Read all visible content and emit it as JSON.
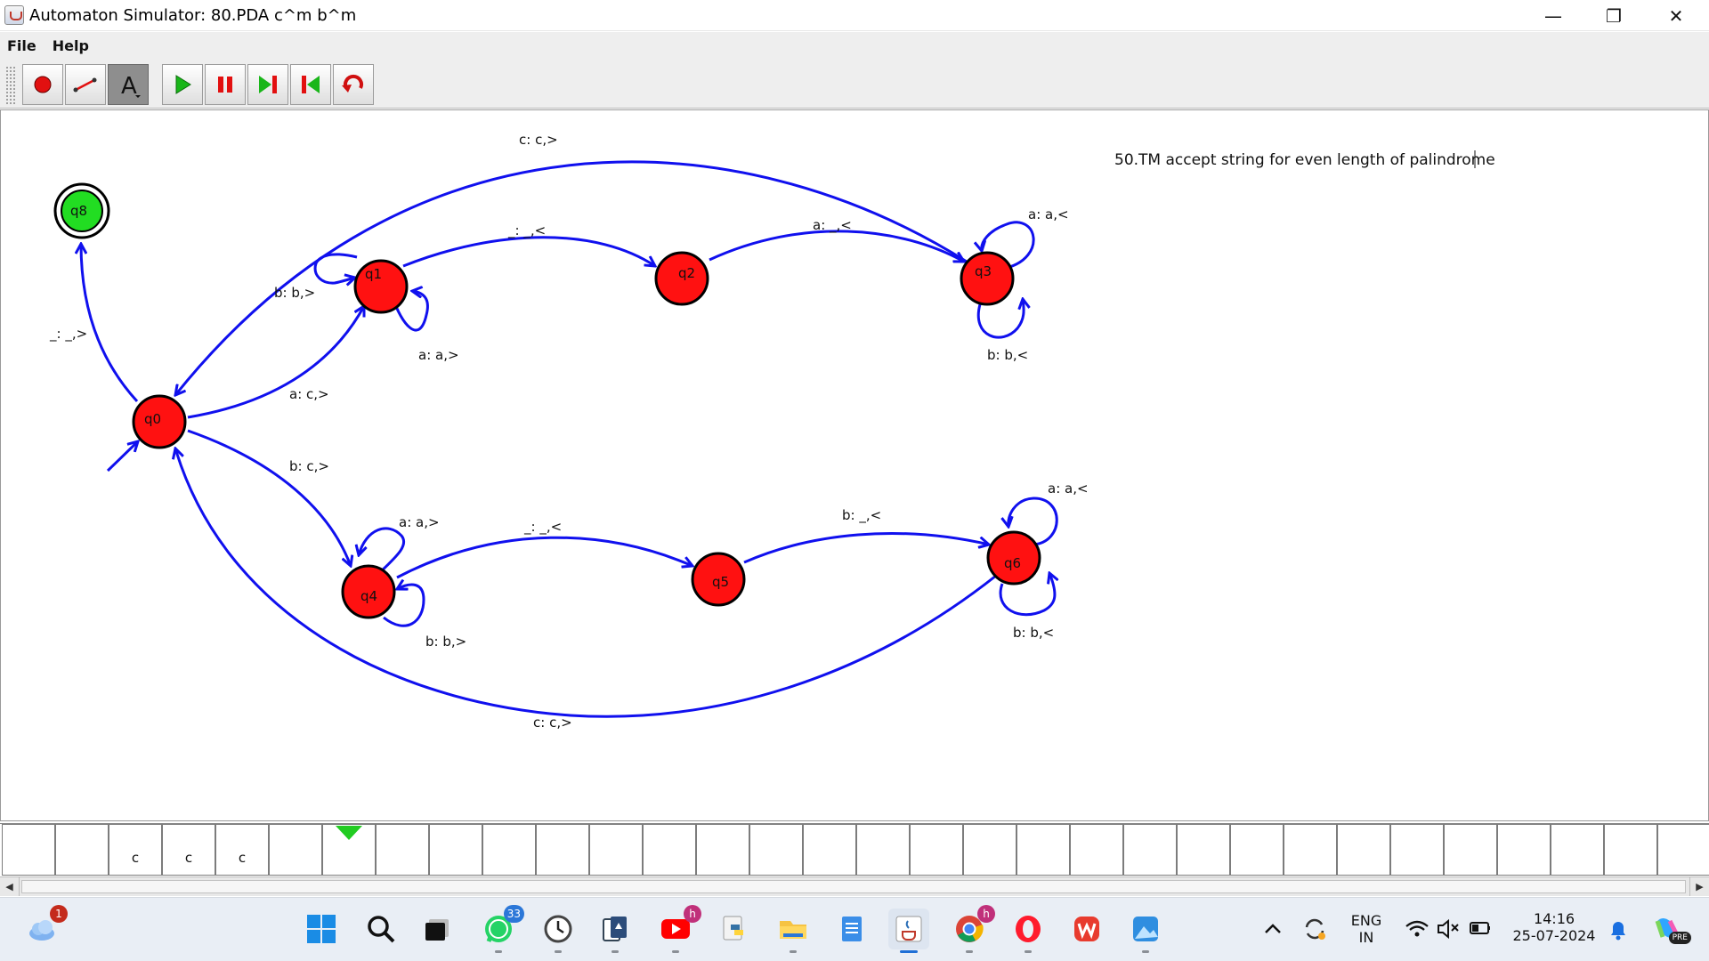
{
  "window": {
    "title": "Automaton Simulator: 80.PDA c^m b^m",
    "controls": {
      "minimize": "—",
      "maximize": "❐",
      "close": "✕"
    }
  },
  "menu": {
    "items": [
      "File",
      "Help"
    ]
  },
  "toolbar": {
    "tools": [
      "state-tool",
      "transition-tool",
      "text-tool"
    ],
    "playback": [
      "run",
      "pause",
      "step",
      "reset",
      "undo"
    ],
    "text_tool_glyph": "A"
  },
  "diagram": {
    "note": "50.TM accept string for even length of palindrome",
    "states": [
      {
        "id": "q8",
        "label": "q8",
        "accepting": true,
        "color": "#22dd22"
      },
      {
        "id": "q1",
        "label": "q1",
        "accepting": false,
        "color": "#ff1111"
      },
      {
        "id": "q2",
        "label": "q2",
        "accepting": false,
        "color": "#ff1111"
      },
      {
        "id": "q3",
        "label": "q3",
        "accepting": false,
        "color": "#ff1111"
      },
      {
        "id": "q0",
        "label": "q0",
        "accepting": false,
        "initial": true,
        "color": "#ff1111"
      },
      {
        "id": "q4",
        "label": "q4",
        "accepting": false,
        "color": "#ff1111"
      },
      {
        "id": "q5",
        "label": "q5",
        "accepting": false,
        "color": "#ff1111"
      },
      {
        "id": "q6",
        "label": "q6",
        "accepting": false,
        "color": "#ff1111"
      }
    ],
    "transitions": [
      {
        "from": "q3",
        "to": "q0",
        "label": "c: c,>"
      },
      {
        "from": "q1",
        "to": "q2",
        "label": "_: _,<"
      },
      {
        "from": "q2",
        "to": "q3",
        "label": "a: _,<"
      },
      {
        "from": "q3",
        "to": "q3",
        "label": "a: a,<"
      },
      {
        "from": "q3",
        "to": "q3",
        "label": "b: b,<"
      },
      {
        "from": "q1",
        "to": "q1",
        "label": "b: b,>"
      },
      {
        "from": "q1",
        "to": "q1",
        "label": "a: a,>"
      },
      {
        "from": "q0",
        "to": "q8",
        "label": "_: _,>"
      },
      {
        "from": "q0",
        "to": "q1",
        "label": "a: c,>"
      },
      {
        "from": "q0",
        "to": "q4",
        "label": "b: c,>"
      },
      {
        "from": "q4",
        "to": "q4",
        "label": "a: a,>"
      },
      {
        "from": "q4",
        "to": "q4",
        "label": "b: b,>"
      },
      {
        "from": "q4",
        "to": "q5",
        "label": "_: _,<"
      },
      {
        "from": "q5",
        "to": "q6",
        "label": "b: _,<"
      },
      {
        "from": "q6",
        "to": "q6",
        "label": "a: a,<"
      },
      {
        "from": "q6",
        "to": "q6",
        "label": "b: b,<"
      },
      {
        "from": "q6",
        "to": "q0",
        "label": "c: c,>"
      }
    ],
    "edge_color": "#1010ee"
  },
  "tape": {
    "cells": [
      "",
      "",
      "c",
      "c",
      "c",
      "",
      "",
      "",
      "",
      "",
      "",
      "",
      "",
      "",
      "",
      "",
      "",
      "",
      "",
      "",
      "",
      "",
      "",
      "",
      "",
      "",
      "",
      "",
      "",
      "",
      "",
      "",
      ""
    ],
    "head_index": 6,
    "head_color": "#22cc22"
  },
  "taskbar": {
    "apps": [
      "weather",
      "start",
      "search",
      "task-view",
      "whatsapp",
      "clock",
      "solitaire",
      "youtube",
      "python",
      "file-explorer",
      "notepad",
      "java",
      "chrome",
      "opera",
      "wps-office",
      "photos"
    ],
    "badges": {
      "weather": "1",
      "whatsapp": "33",
      "youtube": "h",
      "chrome": "h"
    },
    "tray": {
      "language_top": "ENG",
      "language_bottom": "IN",
      "time": "14:16",
      "date": "25-07-2024",
      "copilot_badge": "PRE"
    }
  }
}
